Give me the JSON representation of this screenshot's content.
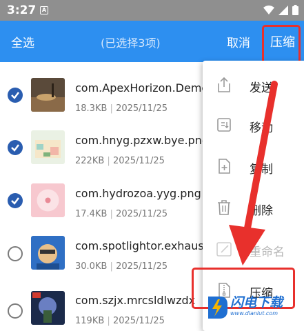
{
  "status_bar": {
    "time": "3:27",
    "notification_glyph": "A"
  },
  "action_bar": {
    "select_all": "全选",
    "selection_count": "(已选择3项)",
    "cancel": "取消",
    "compress": "压缩"
  },
  "files": [
    {
      "name": "com.ApexHorizon.Demo",
      "size": "18.3KB",
      "date": "2025/11/25",
      "selected": true
    },
    {
      "name": "com.hnyg.pzxw.bye.png",
      "size": "222KB",
      "date": "2025/11/25",
      "selected": true
    },
    {
      "name": "com.hydrozoa.yyg.png",
      "size": "17.4KB",
      "date": "2025/11/25",
      "selected": true
    },
    {
      "name": "com.spotlightor.exhaust",
      "size": "30.0KB",
      "date": "2025/11/25",
      "selected": false
    },
    {
      "name": "com.szjx.mrcsldlwzdx",
      "size": "119KB",
      "date": "2025/11/25",
      "selected": false
    }
  ],
  "meta_separator": "|",
  "menu": {
    "items": [
      {
        "label": "发送",
        "icon": "share-icon",
        "enabled": true
      },
      {
        "label": "移动",
        "icon": "move-icon",
        "enabled": true
      },
      {
        "label": "复制",
        "icon": "copy-icon",
        "enabled": true
      },
      {
        "label": "删除",
        "icon": "trash-icon",
        "enabled": true
      },
      {
        "label": "重命名",
        "icon": "rename-icon",
        "enabled": false
      },
      {
        "label": "压缩",
        "icon": "zip-icon",
        "enabled": true
      }
    ]
  },
  "watermark": {
    "text": "闪电下载",
    "url": "www.dianlut.com"
  },
  "colors": {
    "status_bar": "#8f8f8f",
    "action_bar": "#2d8ff0",
    "checkbox_checked": "#2a5db0",
    "highlight_red": "#e8302c"
  }
}
